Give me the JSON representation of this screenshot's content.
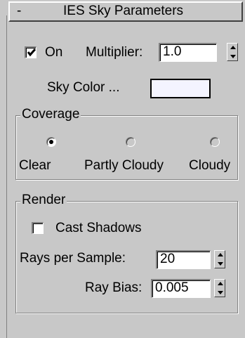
{
  "rollout": {
    "collapse_symbol": "-",
    "title": "IES Sky Parameters"
  },
  "on": {
    "label": "On",
    "checked": true
  },
  "multiplier": {
    "label": "Multiplier:",
    "value": "1.0"
  },
  "sky_color": {
    "label": "Sky Color ...",
    "color": "#f4f4ff"
  },
  "coverage": {
    "title": "Coverage",
    "options": [
      {
        "label": "Clear",
        "selected": true
      },
      {
        "label": "Partly Cloudy",
        "selected": false
      },
      {
        "label": "Cloudy",
        "selected": false
      }
    ]
  },
  "render": {
    "title": "Render",
    "cast_shadows": {
      "label": "Cast Shadows",
      "checked": false
    },
    "rays_per_sample": {
      "label": "Rays per Sample:",
      "value": "20"
    },
    "ray_bias": {
      "label": "Ray Bias:",
      "value": "0.005"
    }
  }
}
